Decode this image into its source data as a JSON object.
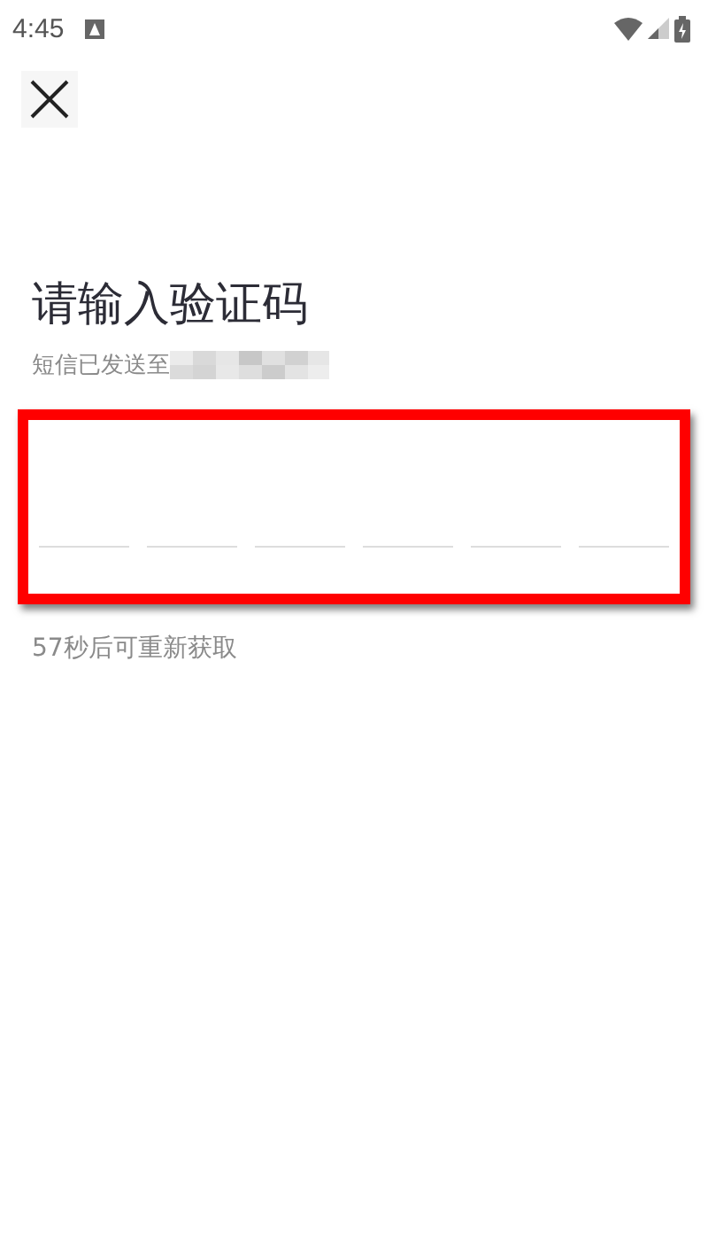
{
  "status_bar": {
    "time": "4:45"
  },
  "title": "请输入验证码",
  "subtitle": "短信已发送至",
  "code_slots": [
    {
      "filled": false
    },
    {
      "filled": false
    },
    {
      "filled": false
    },
    {
      "filled": false
    },
    {
      "filled": false
    },
    {
      "filled": false
    }
  ],
  "resend_countdown": "57秒后可重新获取"
}
